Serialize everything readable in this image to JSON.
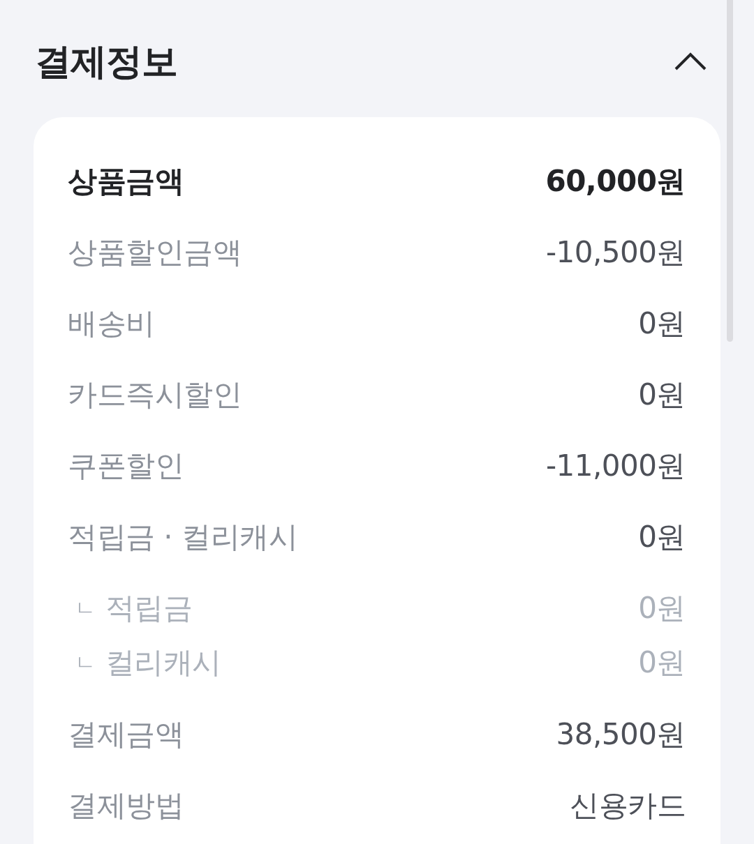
{
  "section": {
    "title": "결제정보",
    "expanded": true
  },
  "rows": [
    {
      "kind": "primary",
      "label": "상품금액",
      "value": "60,000원"
    },
    {
      "kind": "normal",
      "label": "상품할인금액",
      "value": "-10,500원"
    },
    {
      "kind": "normal",
      "label": "배송비",
      "value": "0원"
    },
    {
      "kind": "normal",
      "label": "카드즉시할인",
      "value": "0원"
    },
    {
      "kind": "normal",
      "label": "쿠폰할인",
      "value": "-11,000원"
    },
    {
      "kind": "normal",
      "label": "적립금 · 컬리캐시",
      "value": "0원",
      "children": [
        {
          "marker": "ㄴ",
          "label": "적립금",
          "value": "0원"
        },
        {
          "marker": "ㄴ",
          "label": "컬리캐시",
          "value": "0원"
        }
      ]
    },
    {
      "kind": "normal",
      "label": "결제금액",
      "value": "38,500원"
    },
    {
      "kind": "normal",
      "label": "결제방법",
      "value": "신용카드"
    }
  ]
}
